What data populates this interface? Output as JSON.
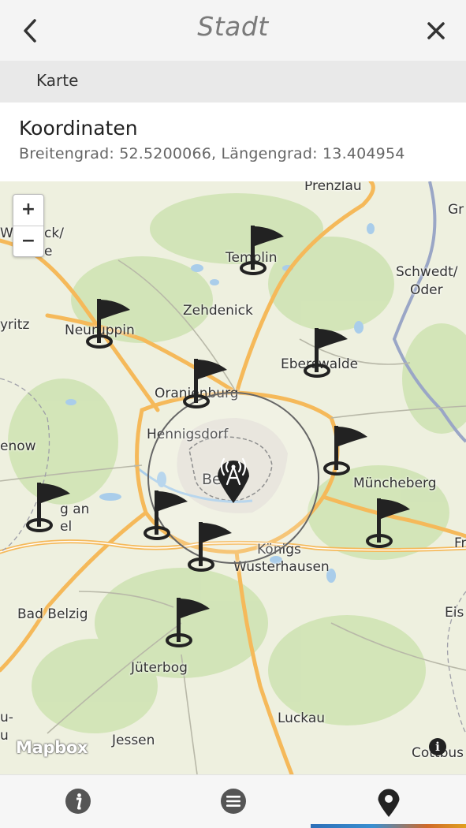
{
  "header": {
    "title": "Stadt",
    "back_icon": "chevron-left-icon",
    "close_icon": "close-icon"
  },
  "section": {
    "label": "Karte"
  },
  "coordinates": {
    "title": "Koordinaten",
    "value": "Breitengrad: 52.5200066, Längengrad: 13.404954"
  },
  "map": {
    "zoom_in": "+",
    "zoom_out": "−",
    "attribution": "Mapbox",
    "info": "i",
    "places": [
      "Prenzlau",
      "Gr",
      "Wi",
      "ck/",
      "e",
      "Templin",
      "Schwedt/",
      "Oder",
      "yritz",
      "Neuruppin",
      "Zehdenick",
      "Eberswalde",
      "Oranienburg",
      "Hennigsdorf",
      "enow",
      "Berlin",
      "g an",
      "el",
      "Müncheberg",
      "Fr",
      "Königs",
      "Wusterhausen",
      "Bad Belzig",
      "Eis",
      "Jüterbog",
      "u-",
      "u",
      "Luckau",
      "Jessen",
      "Cottbus"
    ],
    "marker_icon": "flag-marker-icon",
    "center_icon": "radio-tower-pin-icon"
  },
  "tabs": [
    {
      "name": "info",
      "icon": "info-icon"
    },
    {
      "name": "list",
      "icon": "list-icon"
    },
    {
      "name": "map",
      "icon": "location-pin-icon",
      "active": true
    }
  ],
  "colors": {
    "header_bg": "#f4f4f4",
    "section_bg": "#e9e9e9",
    "road": "#f5b95a",
    "water": "#a9cdea",
    "forest": "#cfe3b4"
  }
}
